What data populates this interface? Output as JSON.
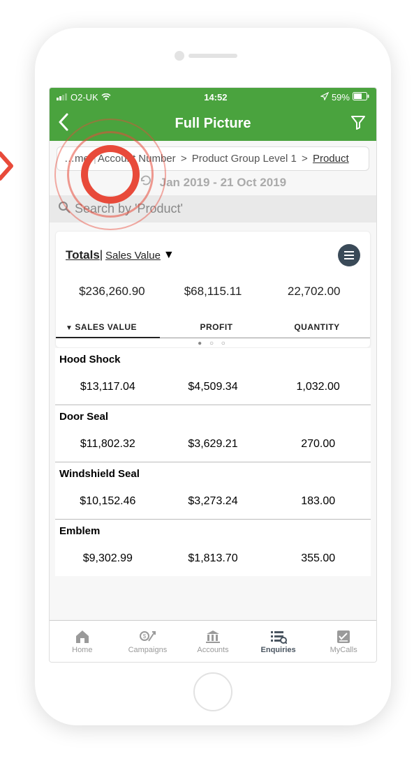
{
  "statusbar": {
    "carrier": "O2-UK",
    "time": "14:52",
    "battery": "59%"
  },
  "navbar": {
    "title": "Full Picture"
  },
  "breadcrumb": {
    "prefix": "…me",
    "sep": "|",
    "item1": "Account Number",
    "item2": "Product Group Level 1",
    "item3": "Product",
    "gt": ">"
  },
  "daterange": {
    "text": "Jan 2019 - 21 Oct 2019"
  },
  "search": {
    "placeholder": "Search by 'Product'"
  },
  "totals": {
    "title": "Totals ",
    "pipe": "| ",
    "metric": "Sales Value",
    "arrow": "▼",
    "values": {
      "sales": "$236,260.90",
      "profit": "$68,115.11",
      "quantity": "22,702.00"
    }
  },
  "columns": {
    "c0arrow": "▼",
    "c0": "SALES VALUE",
    "c1": "PROFIT",
    "c2": "QUANTITY"
  },
  "rows": [
    {
      "name": "Hood Shock",
      "sales": "$13,117.04",
      "profit": "$4,509.34",
      "quantity": "1,032.00"
    },
    {
      "name": "Door Seal",
      "sales": "$11,802.32",
      "profit": "$3,629.21",
      "quantity": "270.00"
    },
    {
      "name": "Windshield Seal",
      "sales": "$10,152.46",
      "profit": "$3,273.24",
      "quantity": "183.00"
    },
    {
      "name": "Emblem",
      "sales": "$9,302.99",
      "profit": "$1,813.70",
      "quantity": "355.00"
    }
  ],
  "tabs": {
    "home": "Home",
    "campaigns": "Campaigns",
    "accounts": "Accounts",
    "enquiries": "Enquiries",
    "mycalls": "MyCalls"
  },
  "pagination_dots": "● ○ ○"
}
